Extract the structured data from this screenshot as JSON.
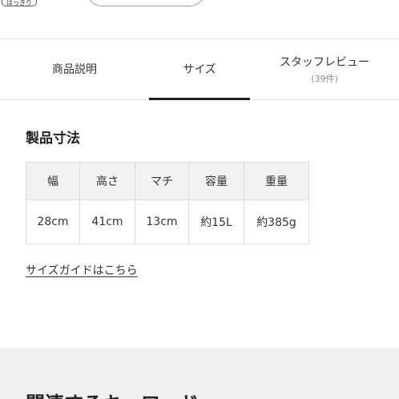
{
  "header": {
    "badge_text": "はっきり"
  },
  "tabs": [
    {
      "label": "商品説明",
      "sub": ""
    },
    {
      "label": "サイズ",
      "sub": ""
    },
    {
      "label": "スタッフレビュー",
      "sub": "(39件)"
    }
  ],
  "section": {
    "title": "製品寸法",
    "table": {
      "headers": [
        "幅",
        "高さ",
        "マチ",
        "容量",
        "重量"
      ],
      "rows": [
        [
          "28cm",
          "41cm",
          "13cm",
          "約15L",
          "約385g"
        ]
      ]
    },
    "guide_link": "サイズガイドはこちら"
  },
  "related": {
    "title": "関連するキーワード"
  }
}
